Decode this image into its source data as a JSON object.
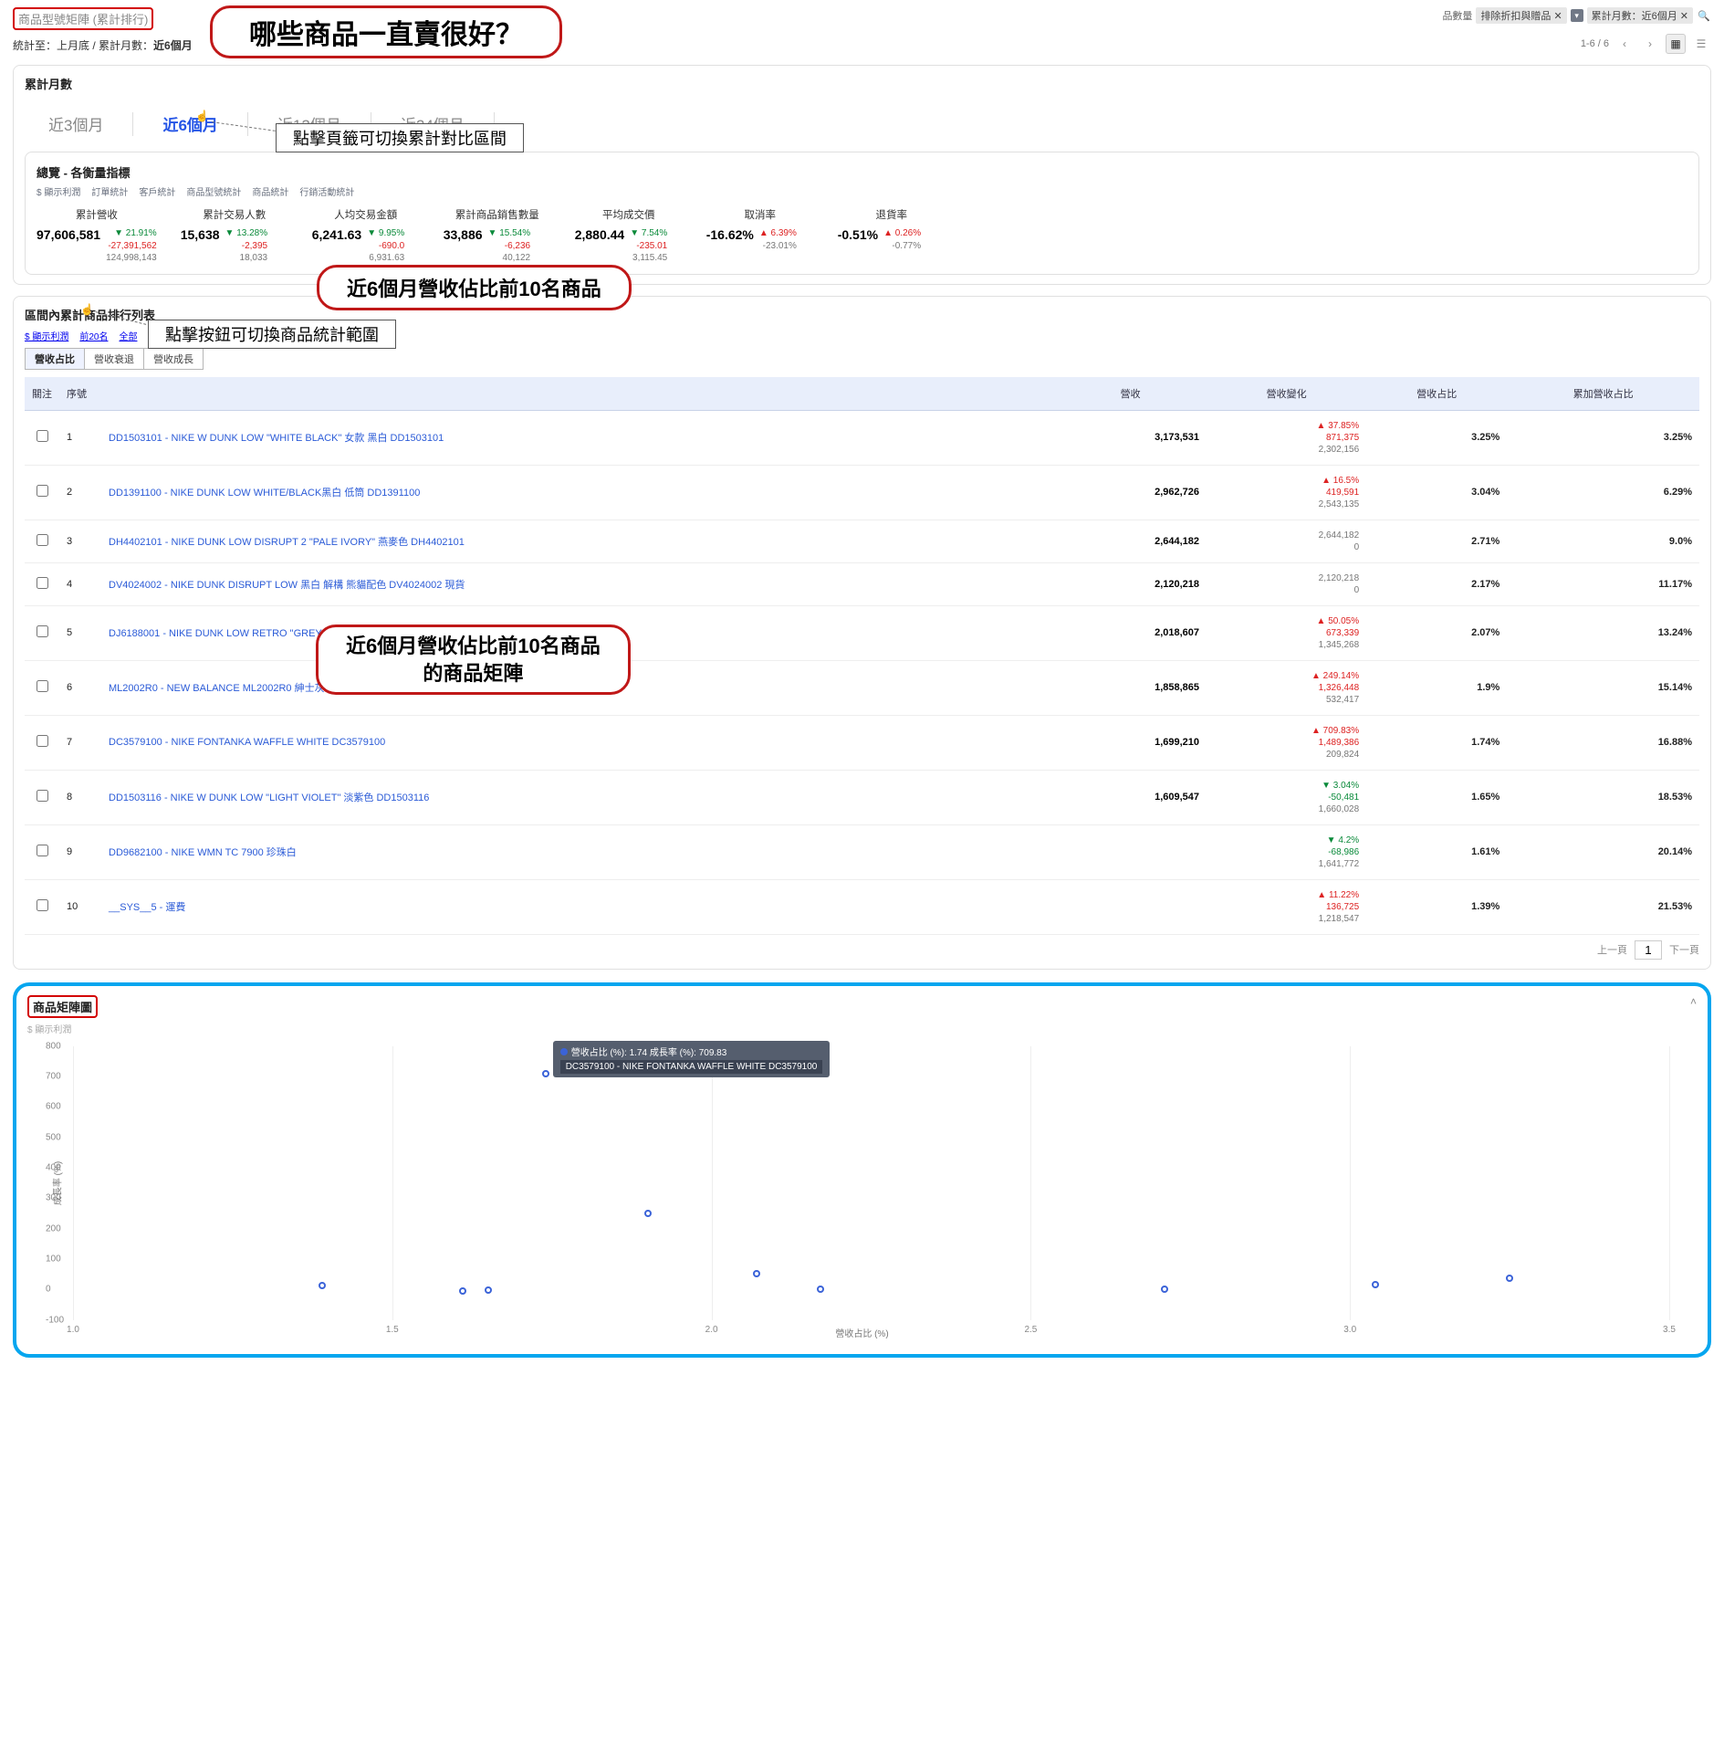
{
  "header": {
    "title_small": "商品型號矩陣 (累計排行)",
    "subtitle_prefix": "統計至：上月底 / 累計月數：",
    "subtitle_bold": "近6個月",
    "right_label": "品數量",
    "chip1_prefix": "排除折扣與贈品",
    "chip2_prefix": "累計月數：近6個月",
    "pager_count": "1-6 / 6"
  },
  "annotations": {
    "main_q": "哪些商品一直賣很好？",
    "tab_note": "點擊頁籤可切換累計對比區間",
    "middle": "近6個月營收佔比前10名商品",
    "scope_note": "點擊按鈕可切換商品統計範圍",
    "bottom_l1": "近6個月營收佔比前10名商品",
    "bottom_l2": "的商品矩陣"
  },
  "tabs": {
    "card_title": "累計月數",
    "t3": "近3個月",
    "t6": "近6個月",
    "t12": "近12個月",
    "t24": "近24個月"
  },
  "overview": {
    "title": "總覽 - 各衡量指標",
    "links": [
      "$ 顯示利潤",
      "訂單統計",
      "客戶統計",
      "商品型號統計",
      "商品統計",
      "行銷活動統計"
    ],
    "cols": [
      {
        "lab": "累計營收",
        "main": "97,606,581",
        "d": [
          {
            "t": "▼ 21.91%",
            "c": "dn"
          },
          {
            "t": "-27,391,562",
            "c": "up"
          },
          {
            "t": "124,998,143",
            "c": "mute"
          }
        ]
      },
      {
        "lab": "累計交易人數",
        "main": "15,638",
        "d": [
          {
            "t": "▼ 13.28%",
            "c": "dn"
          },
          {
            "t": "-2,395",
            "c": "up"
          },
          {
            "t": "18,033",
            "c": "mute"
          }
        ]
      },
      {
        "lab": "人均交易金額",
        "main": "6,241.63",
        "d": [
          {
            "t": "▼ 9.95%",
            "c": "dn"
          },
          {
            "t": "-690.0",
            "c": "up"
          },
          {
            "t": "6,931.63",
            "c": "mute"
          }
        ]
      },
      {
        "lab": "累計商品銷售數量",
        "main": "33,886",
        "d": [
          {
            "t": "▼ 15.54%",
            "c": "dn"
          },
          {
            "t": "-6,236",
            "c": "up"
          },
          {
            "t": "40,122",
            "c": "mute"
          }
        ]
      },
      {
        "lab": "平均成交價",
        "main": "2,880.44",
        "d": [
          {
            "t": "▼ 7.54%",
            "c": "dn"
          },
          {
            "t": "-235.01",
            "c": "up"
          },
          {
            "t": "3,115.45",
            "c": "mute"
          }
        ]
      },
      {
        "lab": "取消率",
        "main": "-16.62%",
        "d": [
          {
            "t": "▲ 6.39%",
            "c": "up"
          },
          {
            "t": "-23.01%",
            "c": "mute"
          }
        ]
      },
      {
        "lab": "退貨率",
        "main": "-0.51%",
        "d": [
          {
            "t": "▲ 0.26%",
            "c": "up"
          },
          {
            "t": "-0.77%",
            "c": "mute"
          }
        ]
      }
    ]
  },
  "ranking": {
    "title": "區間內累計商品排行列表",
    "tools": [
      "$ 顯示利潤",
      "前20名",
      "全部"
    ],
    "seg": [
      "營收占比",
      "營收衰退",
      "營收成長"
    ],
    "thead": [
      "關注",
      "序號",
      "",
      "營收",
      "營收變化",
      "營收占比",
      "累加營收占比"
    ],
    "rows": [
      {
        "i": 1,
        "name": "DD1503101 - NIKE W DUNK LOW \"WHITE BLACK\" 女款 黑白 DD1503101",
        "rev": "3,173,531",
        "chg": [
          {
            "t": "▲ 37.85%",
            "c": "up"
          },
          {
            "t": "871,375",
            "c": "up"
          },
          {
            "t": "2,302,156",
            "c": "mute"
          }
        ],
        "p": "3.25%",
        "cp": "3.25%"
      },
      {
        "i": 2,
        "name": "DD1391100 - NIKE DUNK LOW WHITE/BLACK黑白 低筒 DD1391100",
        "rev": "2,962,726",
        "chg": [
          {
            "t": "▲ 16.5%",
            "c": "up"
          },
          {
            "t": "419,591",
            "c": "up"
          },
          {
            "t": "2,543,135",
            "c": "mute"
          }
        ],
        "p": "3.04%",
        "cp": "6.29%"
      },
      {
        "i": 3,
        "name": "DH4402101 - NIKE DUNK LOW DISRUPT 2 \"PALE IVORY\" 燕麥色 DH4402101",
        "rev": "2,644,182",
        "chg": [
          {
            "t": "2,644,182",
            "c": "mute"
          },
          {
            "t": "0",
            "c": "mute"
          }
        ],
        "p": "2.71%",
        "cp": "9.0%"
      },
      {
        "i": 4,
        "name": "DV4024002 - NIKE DUNK DISRUPT LOW 黑白 解構 熊貓配色 DV4024002 現貨",
        "rev": "2,120,218",
        "chg": [
          {
            "t": "2,120,218",
            "c": "mute"
          },
          {
            "t": "0",
            "c": "mute"
          }
        ],
        "p": "2.17%",
        "cp": "11.17%"
      },
      {
        "i": 5,
        "name": "DJ6188001 - NIKE DUNK LOW RETRO \"GREY WHITE\" 灰白色 DJ6188001",
        "rev": "2,018,607",
        "chg": [
          {
            "t": "▲ 50.05%",
            "c": "up"
          },
          {
            "t": "673,339",
            "c": "up"
          },
          {
            "t": "1,345,268",
            "c": "mute"
          }
        ],
        "p": "2.07%",
        "cp": "13.24%"
      },
      {
        "i": 6,
        "name": "ML2002R0 - NEW BALANCE ML2002R0 紳士灰",
        "rev": "1,858,865",
        "chg": [
          {
            "t": "▲ 249.14%",
            "c": "up"
          },
          {
            "t": "1,326,448",
            "c": "up"
          },
          {
            "t": "532,417",
            "c": "mute"
          }
        ],
        "p": "1.9%",
        "cp": "15.14%"
      },
      {
        "i": 7,
        "name": "DC3579100 - NIKE FONTANKA WAFFLE WHITE DC3579100",
        "rev": "1,699,210",
        "chg": [
          {
            "t": "▲ 709.83%",
            "c": "up"
          },
          {
            "t": "1,489,386",
            "c": "up"
          },
          {
            "t": "209,824",
            "c": "mute"
          }
        ],
        "p": "1.74%",
        "cp": "16.88%"
      },
      {
        "i": 8,
        "name": "DD1503116 - NIKE W DUNK LOW \"LIGHT VIOLET\" 淡紫色 DD1503116",
        "rev": "1,609,547",
        "chg": [
          {
            "t": "▼ 3.04%",
            "c": "dn"
          },
          {
            "t": "-50,481",
            "c": "dn"
          },
          {
            "t": "1,660,028",
            "c": "mute"
          }
        ],
        "p": "1.65%",
        "cp": "18.53%"
      },
      {
        "i": 9,
        "name": "DD9682100 - NIKE WMN TC 7900 珍珠白",
        "rev": "",
        "chg": [
          {
            "t": "▼ 4.2%",
            "c": "dn"
          },
          {
            "t": "-68,986",
            "c": "dn"
          },
          {
            "t": "1,641,772",
            "c": "mute"
          }
        ],
        "p": "1.61%",
        "cp": "20.14%"
      },
      {
        "i": 10,
        "name": "__SYS__5 - 運費",
        "rev": "",
        "chg": [
          {
            "t": "▲ 11.22%",
            "c": "up"
          },
          {
            "t": "136,725",
            "c": "up"
          },
          {
            "t": "1,218,547",
            "c": "mute"
          }
        ],
        "p": "1.39%",
        "cp": "21.53%"
      }
    ],
    "pager_prev": "上一頁",
    "pager_next": "下一頁",
    "pager_cur": "1"
  },
  "scatter": {
    "title": "商品矩陣圖",
    "sublink": "$ 顯示利潤",
    "ylab": "成長率 (%)",
    "xlab": "營收占比 (%)",
    "tooltip_l1": "營收占比 (%): 1.74 成長率 (%): 709.83",
    "tooltip_l2": "DC3579100 - NIKE FONTANKA WAFFLE WHITE DC3579100"
  },
  "chart_data": {
    "type": "scatter",
    "xlabel": "營收占比 (%)",
    "ylabel": "成長率 (%)",
    "xlim": [
      1.0,
      3.5
    ],
    "ylim": [
      -100,
      800
    ],
    "yticks": [
      -100,
      0,
      100,
      200,
      300,
      400,
      500,
      600,
      700,
      800
    ],
    "xticks": [
      1.0,
      1.5,
      2.0,
      2.5,
      3.0,
      3.5
    ],
    "points": [
      {
        "x": 3.25,
        "y": 37.85,
        "label": "DD1503101"
      },
      {
        "x": 3.04,
        "y": 16.5,
        "label": "DD1391100"
      },
      {
        "x": 2.07,
        "y": 50.05,
        "label": "DJ6188001"
      },
      {
        "x": 1.9,
        "y": 249.14,
        "label": "ML2002R0"
      },
      {
        "x": 1.74,
        "y": 709.83,
        "label": "DC3579100"
      },
      {
        "x": 1.65,
        "y": -3.04,
        "label": "DD1503116"
      },
      {
        "x": 1.61,
        "y": -4.2,
        "label": "DD9682100"
      },
      {
        "x": 1.39,
        "y": 11.22,
        "label": "__SYS__5"
      },
      {
        "x": 2.71,
        "y": 0,
        "label": "DH4402101"
      },
      {
        "x": 2.17,
        "y": 0,
        "label": "DV4024002"
      }
    ]
  }
}
